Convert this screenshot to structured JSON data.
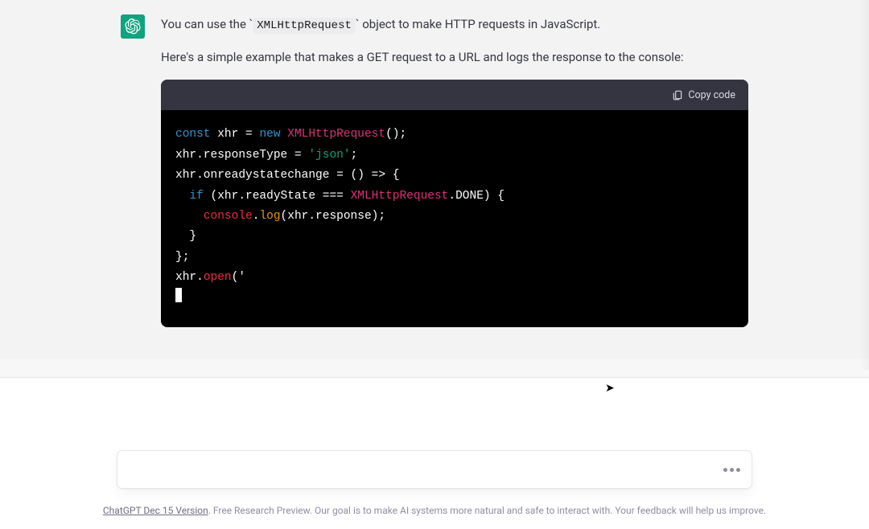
{
  "message": {
    "intro_before_code": "You can use the ",
    "inline_code": "XMLHttpRequest",
    "intro_after_code": " object to make HTTP requests in JavaScript.",
    "example_intro": "Here's a simple example that makes a GET request to a URL and logs the response to the console:"
  },
  "code_block": {
    "copy_label": "Copy code",
    "tokens": {
      "l1_const": "const",
      "l1_rest1": " xhr ",
      "l1_eq": "=",
      "l1_rest2": " ",
      "l1_new": "new",
      "l1_rest3": " ",
      "l1_cls": "XMLHttpRequest",
      "l1_rest4": "();",
      "l2_a": "xhr.responseType ",
      "l2_eq": "=",
      "l2_b": " ",
      "l2_str": "'json'",
      "l2_c": ";",
      "l3_a": "xhr.onreadystatechange ",
      "l3_eq": "=",
      "l3_b": " () ",
      "l3_arrow": "=>",
      "l3_c": " {",
      "l4_indent": "  ",
      "l4_if": "if",
      "l4_a": " (xhr.readyState ",
      "l4_eqq": "===",
      "l4_b": " ",
      "l4_cls": "XMLHttpRequest",
      "l4_c": ".DONE) {",
      "l5_indent": "    ",
      "l5_console": "console",
      "l5_dot": ".",
      "l5_log": "log",
      "l5_rest": "(xhr.response);",
      "l6": "  }",
      "l7": "};",
      "l8_a": "xhr.",
      "l8_open": "open",
      "l8_b": "('"
    }
  },
  "footer": {
    "version_link": "ChatGPT Dec 15 Version",
    "disclaimer": ". Free Research Preview. Our goal is to make AI systems more natural and safe to interact with. Your feedback will help us improve."
  }
}
